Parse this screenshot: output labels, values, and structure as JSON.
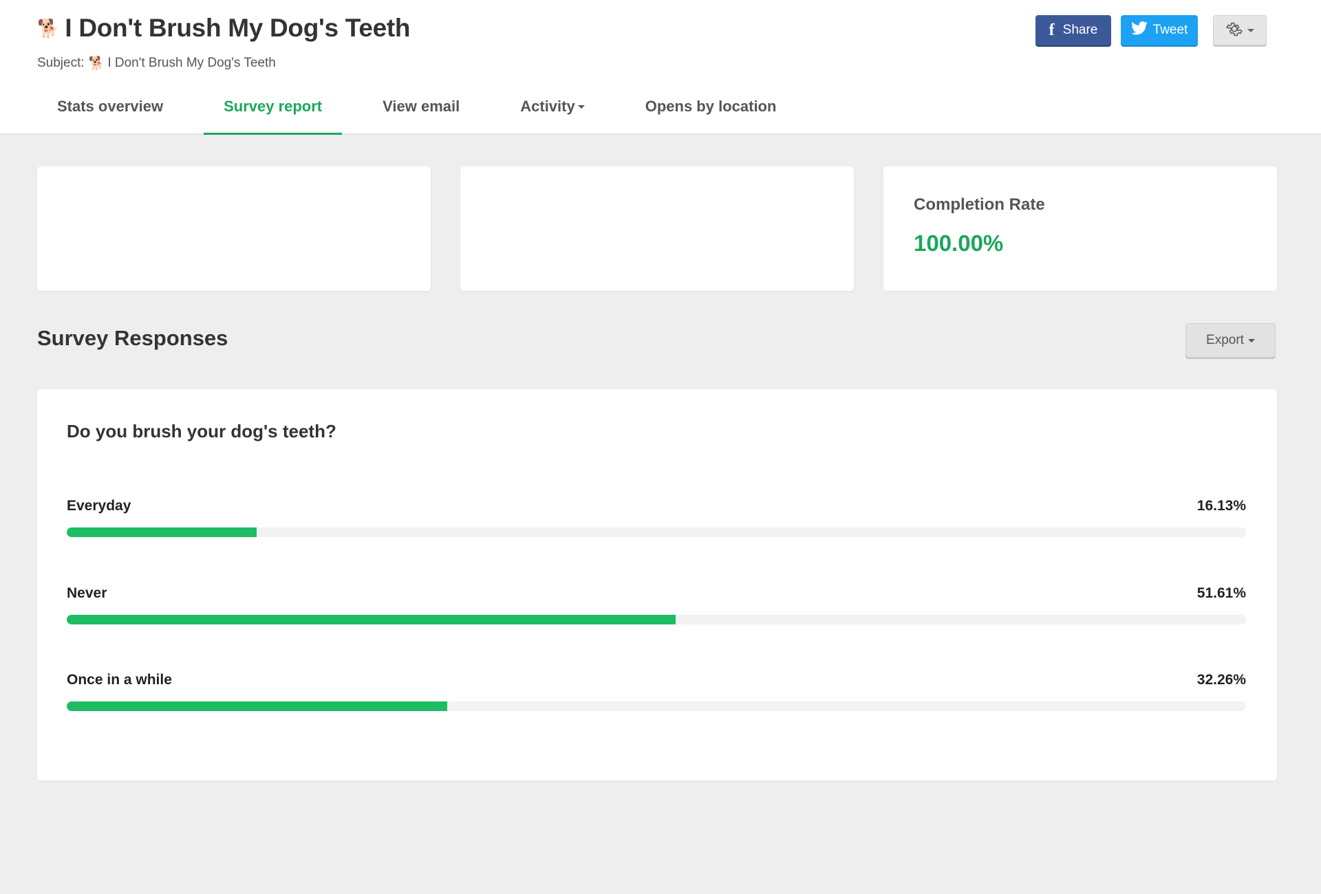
{
  "header": {
    "title_emoji": "🐕",
    "title": "I Don't Brush My Dog's Teeth",
    "subject_label": "Subject:",
    "subject_emoji": "🐕",
    "subject_text": "I Don't Brush My Dog's Teeth",
    "share_label": "Share",
    "tweet_label": "Tweet",
    "icons": {
      "share": "facebook-icon",
      "tweet": "twitter-icon",
      "settings": "gear-icon"
    }
  },
  "tabs": [
    {
      "label": "Stats overview",
      "active": false
    },
    {
      "label": "Survey report",
      "active": true
    },
    {
      "label": "View email",
      "active": false
    },
    {
      "label": "Activity",
      "active": false,
      "dropdown": true
    },
    {
      "label": "Opens by location",
      "active": false
    }
  ],
  "stats": {
    "completion_rate_label": "Completion Rate",
    "completion_rate_value": "100.00%"
  },
  "survey": {
    "section_title": "Survey Responses",
    "export_label": "Export",
    "question": "Do you brush your dog's teeth?",
    "answers": [
      {
        "label": "Everyday",
        "percent_text": "16.13%",
        "percent": 16.13
      },
      {
        "label": "Never",
        "percent_text": "51.61%",
        "percent": 51.61
      },
      {
        "label": "Once in a while",
        "percent_text": "32.26%",
        "percent": 32.26
      }
    ]
  },
  "colors": {
    "accent_green": "#1ba75b",
    "bar_green": "#1ebc63",
    "facebook_blue": "#3b5998",
    "twitter_blue": "#1da1f2"
  }
}
